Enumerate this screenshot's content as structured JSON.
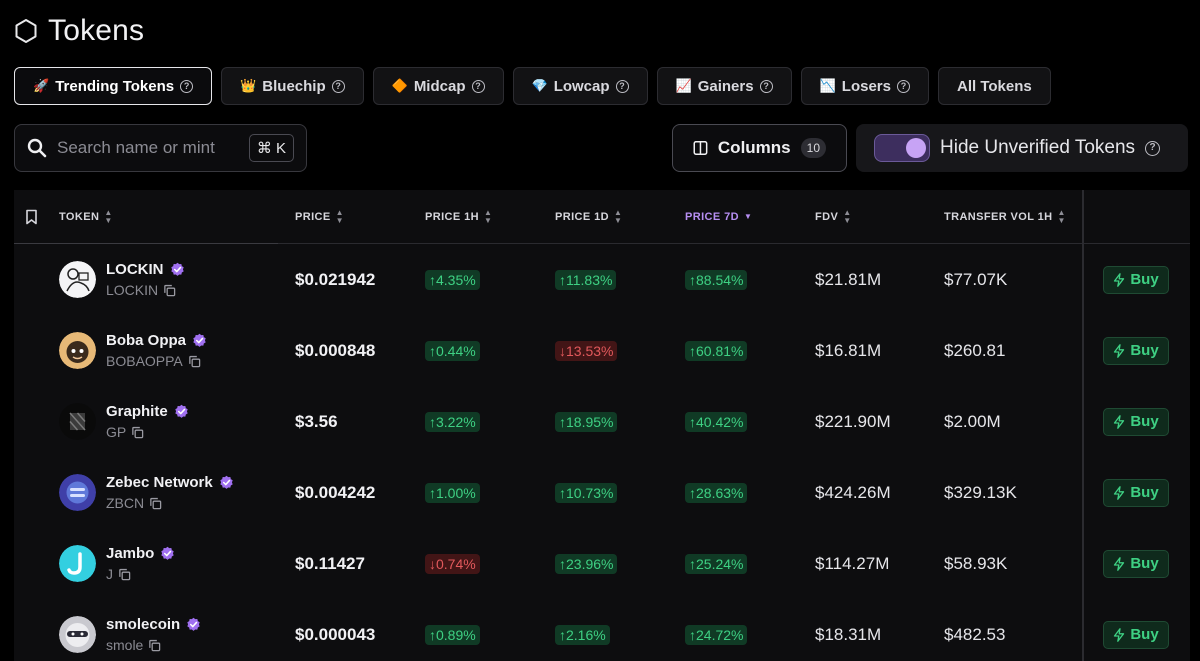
{
  "page": {
    "title": "Tokens",
    "icon": "hexagon-icon"
  },
  "tabs": [
    {
      "label": "Trending Tokens",
      "emoji": "🚀",
      "icon": "rocket-icon",
      "has_help": true,
      "active": true
    },
    {
      "label": "Bluechip",
      "emoji": "👑",
      "icon": "crown-icon",
      "has_help": true,
      "active": false
    },
    {
      "label": "Midcap",
      "emoji": "🔶",
      "icon": "diamond-orange-icon",
      "has_help": true,
      "active": false
    },
    {
      "label": "Lowcap",
      "emoji": "💎",
      "icon": "gem-icon",
      "has_help": true,
      "active": false
    },
    {
      "label": "Gainers",
      "emoji": "📈",
      "icon": "chart-up-icon",
      "has_help": true,
      "active": false
    },
    {
      "label": "Losers",
      "emoji": "📉",
      "icon": "chart-down-icon",
      "has_help": true,
      "active": false
    },
    {
      "label": "All Tokens",
      "emoji": "",
      "icon": "",
      "has_help": false,
      "active": false
    }
  ],
  "search": {
    "placeholder": "Search name or mint",
    "value": "",
    "shortcut": "⌘ K"
  },
  "columns_button": {
    "label": "Columns",
    "count": "10"
  },
  "verify_toggle": {
    "label": "Hide Unverified Tokens",
    "on": true
  },
  "table": {
    "headers": {
      "token": "TOKEN",
      "price": "PRICE",
      "price_1h": "PRICE 1H",
      "price_1d": "PRICE 1D",
      "price_7d": "PRICE 7D",
      "fdv": "FDV",
      "transfer_vol": "TRANSFER VOL 1H"
    },
    "sorted_by": "PRICE 7D",
    "buy_label": "Buy",
    "rows": [
      {
        "name": "LOCKIN",
        "symbol": "LOCKIN",
        "price": "$0.021942",
        "p1h": "↑4.35%",
        "p1h_dir": "up",
        "p1d": "↑11.83%",
        "p1d_dir": "up",
        "p7d": "↑88.54%",
        "p7d_dir": "up",
        "fdv": "$21.81M",
        "vol": "$77.07K"
      },
      {
        "name": "Boba Oppa",
        "symbol": "BOBAOPPA",
        "price": "$0.000848",
        "p1h": "↑0.44%",
        "p1h_dir": "up",
        "p1d": "↓13.53%",
        "p1d_dir": "down",
        "p7d": "↑60.81%",
        "p7d_dir": "up",
        "fdv": "$16.81M",
        "vol": "$260.81"
      },
      {
        "name": "Graphite",
        "symbol": "GP",
        "price": "$3.56",
        "p1h": "↑3.22%",
        "p1h_dir": "up",
        "p1d": "↑18.95%",
        "p1d_dir": "up",
        "p7d": "↑40.42%",
        "p7d_dir": "up",
        "fdv": "$221.90M",
        "vol": "$2.00M"
      },
      {
        "name": "Zebec Network",
        "symbol": "ZBCN",
        "price": "$0.004242",
        "p1h": "↑1.00%",
        "p1h_dir": "up",
        "p1d": "↑10.73%",
        "p1d_dir": "up",
        "p7d": "↑28.63%",
        "p7d_dir": "up",
        "fdv": "$424.26M",
        "vol": "$329.13K"
      },
      {
        "name": "Jambo",
        "symbol": "J",
        "price": "$0.11427",
        "p1h": "↓0.74%",
        "p1h_dir": "down",
        "p1d": "↑23.96%",
        "p1d_dir": "up",
        "p7d": "↑25.24%",
        "p7d_dir": "up",
        "fdv": "$114.27M",
        "vol": "$58.93K"
      },
      {
        "name": "smolecoin",
        "symbol": "smole",
        "price": "$0.000043",
        "p1h": "↑0.89%",
        "p1h_dir": "up",
        "p1d": "↑2.16%",
        "p1d_dir": "up",
        "p7d": "↑24.72%",
        "p7d_dir": "up",
        "fdv": "$18.31M",
        "vol": "$482.53"
      }
    ]
  },
  "colors": {
    "background": "#000000",
    "accent_purple": "#b68ef2",
    "up_green": "#3ed083",
    "down_red": "#e2595c",
    "verified_badge": "#a070f0"
  }
}
